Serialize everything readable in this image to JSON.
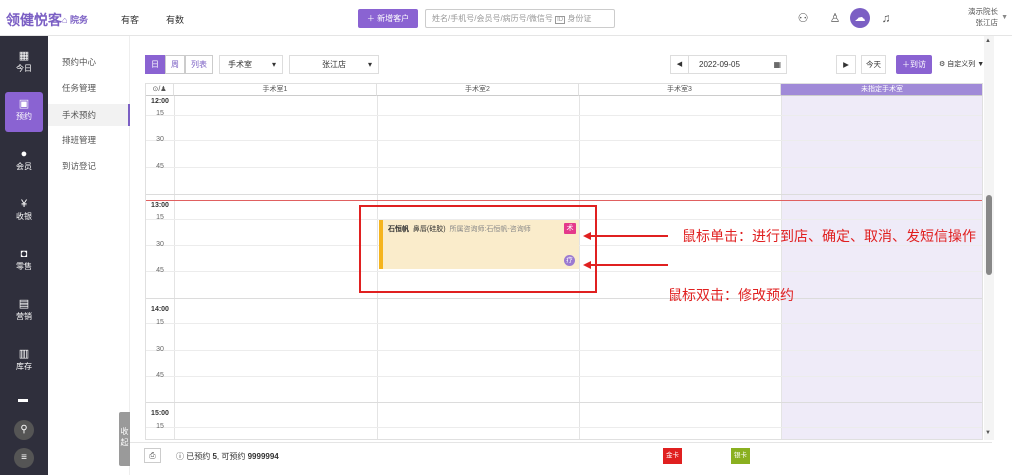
{
  "header": {
    "logo": "领健悦客",
    "nav": [
      {
        "label": "院务"
      },
      {
        "label": "有客"
      },
      {
        "label": "有数"
      }
    ],
    "add_customer": "新增客户",
    "search_placeholder": "姓名/手机号/会员号/病历号/微信号",
    "id_card_label": "身份证",
    "user_name": "演示院长",
    "user_store": "张江店"
  },
  "sidebar": {
    "items": [
      {
        "label": "今日",
        "icon": "calendar-today-icon"
      },
      {
        "label": "预约",
        "icon": "appointment-icon"
      },
      {
        "label": "会员",
        "icon": "member-icon"
      },
      {
        "label": "收银",
        "icon": "cashier-icon"
      },
      {
        "label": "零售",
        "icon": "retail-icon"
      },
      {
        "label": "营销",
        "icon": "marketing-icon"
      },
      {
        "label": "库存",
        "icon": "inventory-icon"
      }
    ]
  },
  "submenu": {
    "items": [
      {
        "label": "预约中心"
      },
      {
        "label": "任务管理"
      },
      {
        "label": "手术预约"
      },
      {
        "label": "排班管理"
      },
      {
        "label": "到访登记"
      }
    ],
    "collapse_label": "收起"
  },
  "toolbar": {
    "view_day": "日",
    "view_week": "周",
    "view_list": "列表",
    "room_select": "手术室",
    "store_select": "张江店",
    "date": "2022-09-05",
    "today": "今天",
    "arrive": "到访",
    "custom_columns": "自定义列"
  },
  "calendar": {
    "corner_label": "⊙/♟",
    "columns": [
      "手术室1",
      "手术室2",
      "手术室3",
      "未指定手术室"
    ],
    "hours": [
      {
        "hour": "12:00",
        "minutes": [
          "15",
          "30",
          "45"
        ]
      },
      {
        "hour": "13:00",
        "minutes": [
          "15",
          "30",
          "45"
        ]
      },
      {
        "hour": "14:00",
        "minutes": [
          "15",
          "30",
          "45"
        ]
      },
      {
        "hour": "15:00",
        "minutes": [
          "15"
        ]
      }
    ],
    "appointment": {
      "patient": "石恒帆",
      "procedure": "鼻唇(硅胶)",
      "consultant": "所属咨询师:石恒帆-咨询师",
      "tag_surgery": "术",
      "tag_treatment": "疗"
    }
  },
  "annotations": {
    "single_click": "鼠标单击：进行到店、确定、取消、发短信操作",
    "double_click": "鼠标双击：修改预约"
  },
  "footer": {
    "booked_label": "已预约",
    "booked_count": "5",
    "available_label": "可预约",
    "available_count": "9999994",
    "legend": [
      {
        "label": "金卡",
        "color": "#e02020"
      },
      {
        "label": "银卡",
        "color": "#8ab020"
      }
    ]
  }
}
